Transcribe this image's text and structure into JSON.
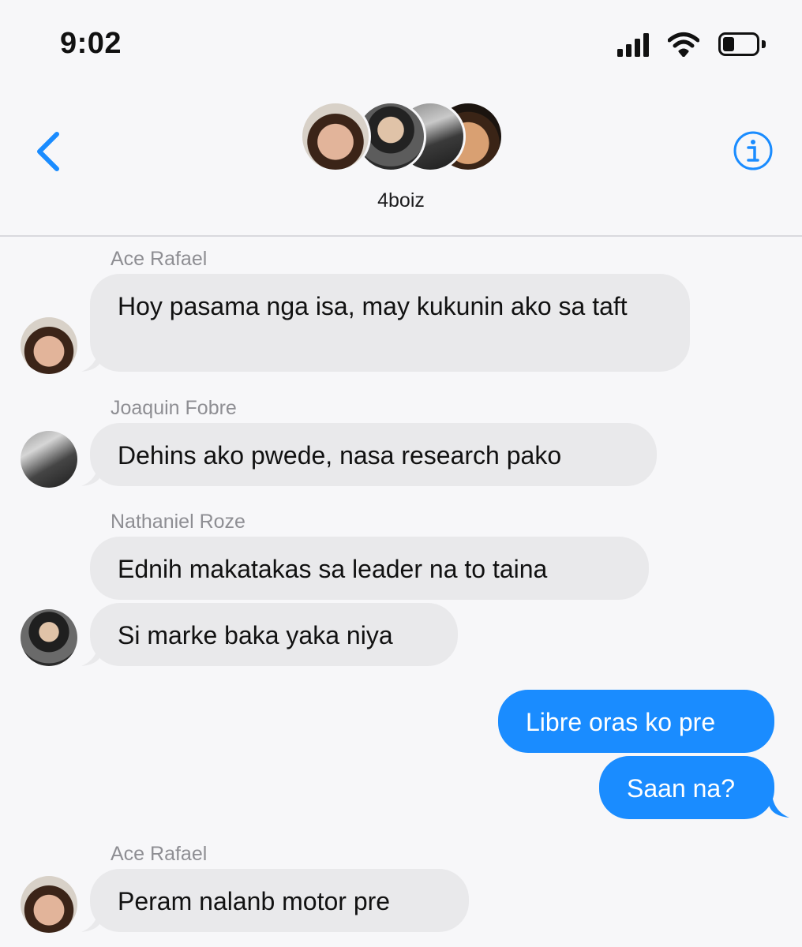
{
  "status_bar": {
    "time": "9:02",
    "signal_bars": 4,
    "battery_level_percent": 35
  },
  "header": {
    "group_name": "4boiz",
    "back_icon": "chevron-left-icon",
    "info_icon": "info-circle-icon"
  },
  "colors": {
    "accent": "#1a8cff",
    "incoming_bubble": "#e9e9eb",
    "background": "#f7f7f9",
    "sender_label": "#8e8e93"
  },
  "messages": [
    {
      "sender": "Ace Rafael",
      "text": "Hoy pasama nga isa, may kukunin ako sa taft",
      "direction": "incoming"
    },
    {
      "sender": "Joaquin Fobre",
      "text": "Dehins ako pwede, nasa research pako",
      "direction": "incoming"
    },
    {
      "sender": "Nathaniel Roze",
      "text": "Ednih makatakas sa leader na to taina",
      "direction": "incoming"
    },
    {
      "sender": "",
      "text": "Si marke baka yaka niya",
      "direction": "incoming"
    },
    {
      "sender": "",
      "text": "Libre oras ko pre",
      "direction": "outgoing"
    },
    {
      "sender": "",
      "text": "Saan na?",
      "direction": "outgoing"
    },
    {
      "sender": "Ace Rafael",
      "text": "Peram nalanb motor pre",
      "direction": "incoming"
    }
  ]
}
